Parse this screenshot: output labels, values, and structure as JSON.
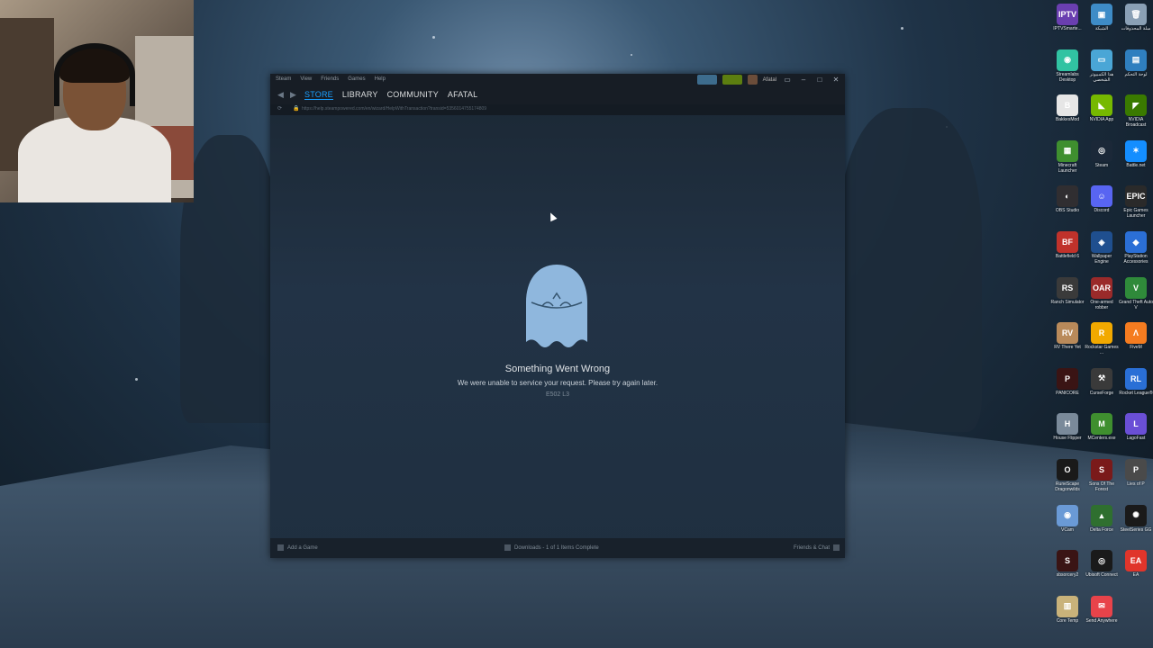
{
  "steam": {
    "menu": [
      "Steam",
      "View",
      "Friends",
      "Games",
      "Help"
    ],
    "account_name": "Afatal",
    "tabs": [
      "STORE",
      "LIBRARY",
      "COMMUNITY",
      "AFATAL"
    ],
    "active_tab": "STORE",
    "url": "https://help.steampowered.com/en/wizard/HelpWithTransaction?transid=5356014755174809",
    "error": {
      "title": "Something Went Wrong",
      "message": "We were unable to service your request. Please try again later.",
      "code": "E502 L3"
    },
    "bottom": {
      "add_game": "Add a Game",
      "downloads": "Downloads - 1 of 1 Items Complete",
      "friends": "Friends & Chat"
    }
  },
  "desktop_icons": [
    {
      "label": "IPTVSmarte...",
      "icon": "iptv-icon",
      "color": "#6a3fb0",
      "glyph": "IPTV"
    },
    {
      "label": "الشبكة",
      "icon": "network-icon",
      "color": "#3e8cc7",
      "glyph": "▣"
    },
    {
      "label": "سلة المحذوفات",
      "icon": "recycle-bin-icon",
      "color": "#8aa0b5",
      "glyph": "🗑"
    },
    {
      "label": "Streamlabs Desktop",
      "icon": "streamlabs-icon",
      "color": "#31c3a2",
      "glyph": "◉"
    },
    {
      "label": "هذا الكمبيوتر الشخصي",
      "icon": "computer-icon",
      "color": "#4aa6d6",
      "glyph": "▭"
    },
    {
      "label": "لوحة التحكم",
      "icon": "control-panel-icon",
      "color": "#2f7fbf",
      "glyph": "▤"
    },
    {
      "label": "BakkesMod",
      "icon": "bakkesmod-icon",
      "color": "#e6e6e6",
      "glyph": "B"
    },
    {
      "label": "NVIDIA App",
      "icon": "nvidia-icon",
      "color": "#76b900",
      "glyph": "◣"
    },
    {
      "label": "NVIDIA Broadcast",
      "icon": "nvidia-broadcast-icon",
      "color": "#3a7a00",
      "glyph": "◤"
    },
    {
      "label": "Minecraft Launcher",
      "icon": "minecraft-icon",
      "color": "#3f8f2f",
      "glyph": "▦"
    },
    {
      "label": "Steam",
      "icon": "steam-icon",
      "color": "#1b2838",
      "glyph": "◎"
    },
    {
      "label": "Battle.net",
      "icon": "battlenet-icon",
      "color": "#148eff",
      "glyph": "✶"
    },
    {
      "label": "OBS Studio",
      "icon": "obs-icon",
      "color": "#302e31",
      "glyph": "◐"
    },
    {
      "label": "Discord",
      "icon": "discord-icon",
      "color": "#5865f2",
      "glyph": "☺"
    },
    {
      "label": "Epic Games Launcher",
      "icon": "epic-games-icon",
      "color": "#2a2a2a",
      "glyph": "EPIC"
    },
    {
      "label": "Battlefield 6",
      "icon": "battlefield-icon",
      "color": "#c0322b",
      "glyph": "BF"
    },
    {
      "label": "Wallpaper Engine",
      "icon": "wallpaper-engine-icon",
      "color": "#1f4f8f",
      "glyph": "◈"
    },
    {
      "label": "PlayStation Accessories",
      "icon": "playstation-icon",
      "color": "#2b6fd6",
      "glyph": "◆"
    },
    {
      "label": "Ranch Simulator",
      "icon": "ranch-simulator-icon",
      "color": "#3a3a3a",
      "glyph": "RS"
    },
    {
      "label": "One-armed robber",
      "icon": "one-armed-robber-icon",
      "color": "#9a2a2a",
      "glyph": "OAR"
    },
    {
      "label": "Grand Theft Auto V",
      "icon": "gta-icon",
      "color": "#2f8a3a",
      "glyph": "V"
    },
    {
      "label": "RV There Yet",
      "icon": "rv-there-yet-icon",
      "color": "#b98a5a",
      "glyph": "RV"
    },
    {
      "label": "Rockstar Games ...",
      "icon": "rockstar-icon",
      "color": "#f2a900",
      "glyph": "R"
    },
    {
      "label": "FiveM",
      "icon": "fivem-icon",
      "color": "#f57c20",
      "glyph": "Λ"
    },
    {
      "label": "PANICORE",
      "icon": "panicore-icon",
      "color": "#3a1414",
      "glyph": "P"
    },
    {
      "label": "CurseForge",
      "icon": "curseforge-icon",
      "color": "#3a3a3a",
      "glyph": "⚒"
    },
    {
      "label": "Rocket League®",
      "icon": "rocket-league-icon",
      "color": "#2a6fd6",
      "glyph": "RL"
    },
    {
      "label": "House Flipper",
      "icon": "house-flipper-icon",
      "color": "#7a8a9a",
      "glyph": "H"
    },
    {
      "label": "MCenters.exe",
      "icon": "mcenters-icon",
      "color": "#3f8f2f",
      "glyph": "M"
    },
    {
      "label": "LagoFast",
      "icon": "lagofast-icon",
      "color": "#6a4fd6",
      "glyph": "L"
    },
    {
      "label": "RuneScape Dragonwilds",
      "icon": "runescape-icon",
      "color": "#1a1a1a",
      "glyph": "O"
    },
    {
      "label": "Sons Of The Forest",
      "icon": "sons-of-the-forest-icon",
      "color": "#7a1a1a",
      "glyph": "S"
    },
    {
      "label": "Lies of P",
      "icon": "lies-of-p-icon",
      "color": "#4a4a4a",
      "glyph": "P"
    },
    {
      "label": "VCam",
      "icon": "vcam-icon",
      "color": "#6a9ad6",
      "glyph": "◉"
    },
    {
      "label": "Delta Force",
      "icon": "delta-force-icon",
      "color": "#2f6f2f",
      "glyph": "▲"
    },
    {
      "label": "SteelSeries GG",
      "icon": "steelseries-icon",
      "color": "#1a1a1a",
      "glyph": "✺"
    },
    {
      "label": "sbsorcery2",
      "icon": "sbsorcery-icon",
      "color": "#3a1414",
      "glyph": "S"
    },
    {
      "label": "Ubisoft Connect",
      "icon": "ubisoft-icon",
      "color": "#1a1a1a",
      "glyph": "◎"
    },
    {
      "label": "EA",
      "icon": "ea-icon",
      "color": "#e0352b",
      "glyph": "EA"
    },
    {
      "label": "Core Temp",
      "icon": "core-temp-icon",
      "color": "#c9b27a",
      "glyph": "▥"
    },
    {
      "label": "Send Anywhere",
      "icon": "send-anywhere-icon",
      "color": "#e8434a",
      "glyph": "✉"
    }
  ]
}
